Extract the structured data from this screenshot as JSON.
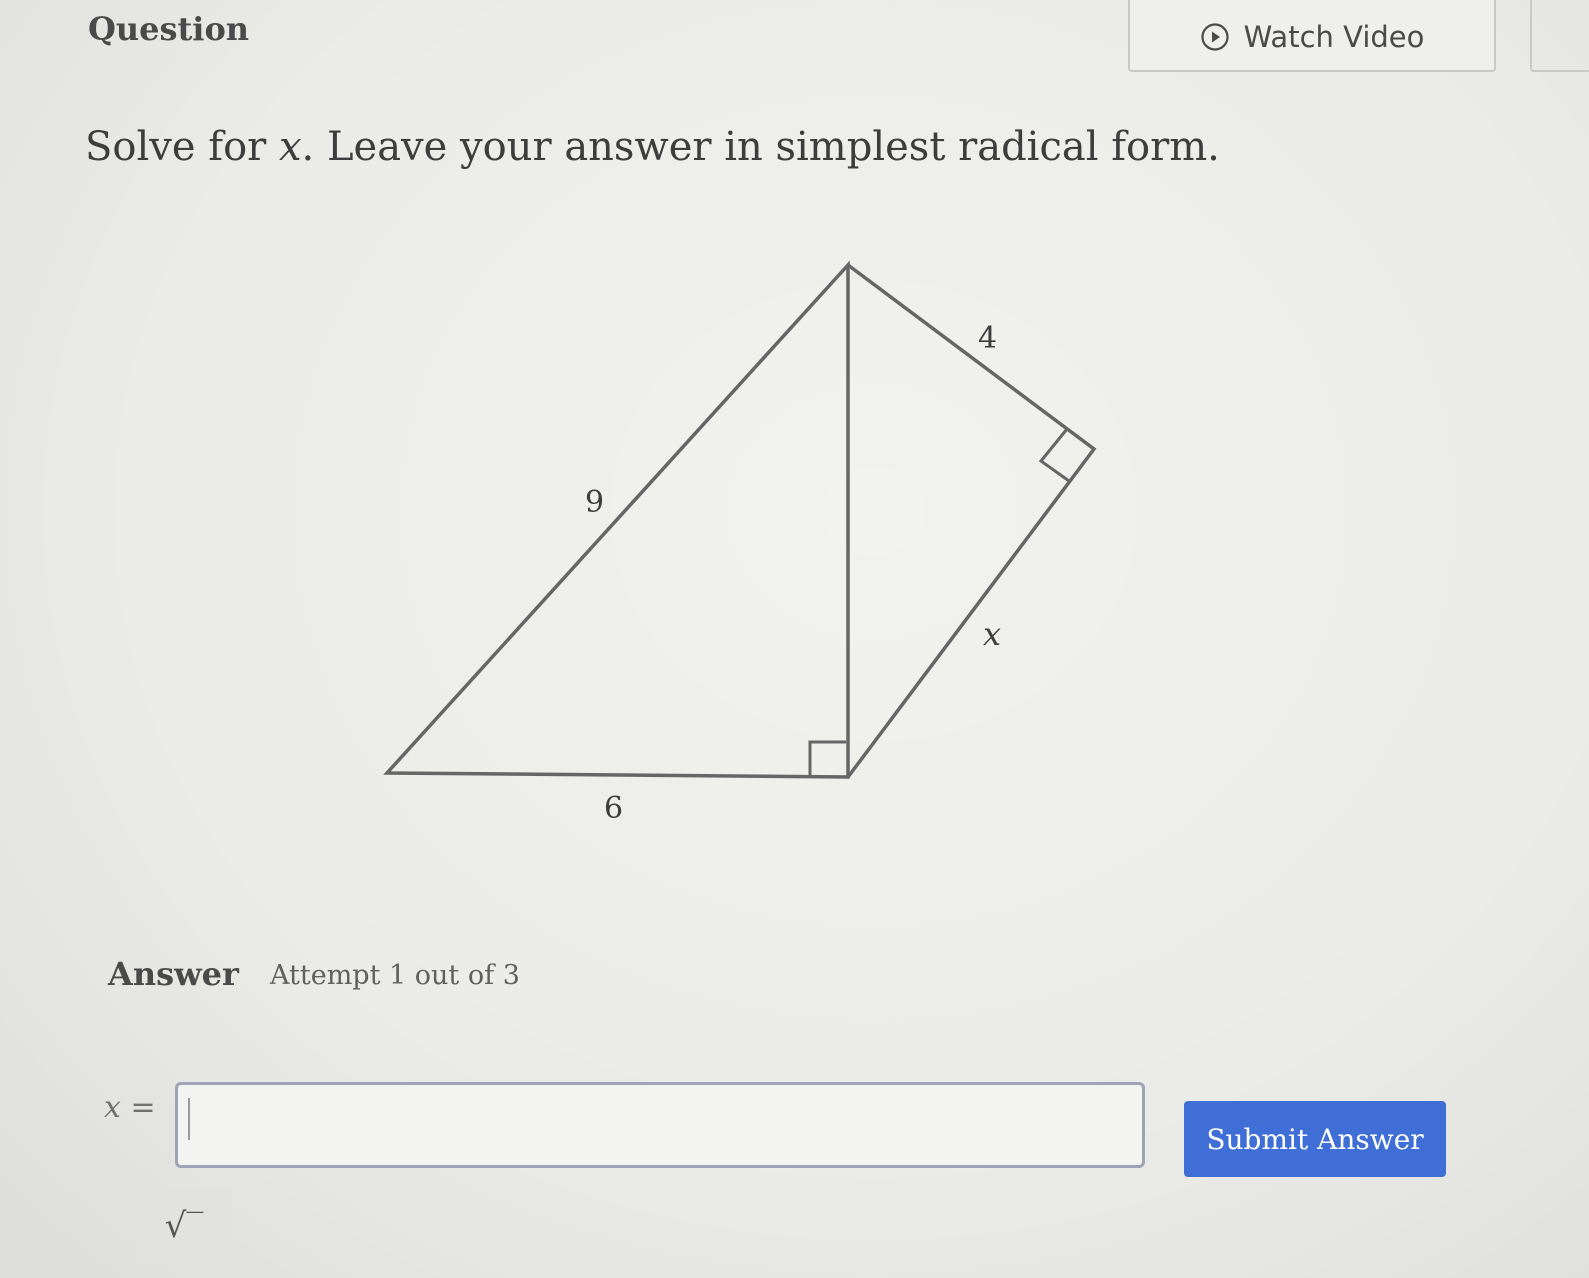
{
  "header": {
    "question_label": "Question",
    "watch_video_label": "Watch Video"
  },
  "prompt": {
    "before_var": "Solve for ",
    "variable": "x",
    "after_var": ". Leave your answer in simplest radical form."
  },
  "figure": {
    "labels": {
      "top_right": "4",
      "left_hypotenuse": "9",
      "right_lower": "x",
      "bottom": "6"
    }
  },
  "answer": {
    "label": "Answer",
    "attempt": "Attempt 1 out of 3",
    "prefix_var": "x",
    "prefix_eq": " =",
    "input_value": "",
    "submit_label": "Submit Answer",
    "sqrt_label": "√‾"
  }
}
